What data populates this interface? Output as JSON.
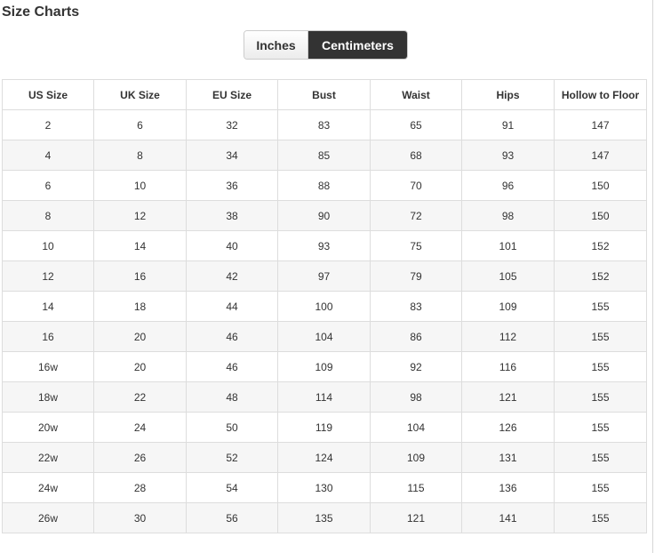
{
  "title": "Size Charts",
  "unit_toggle": {
    "inches_label": "Inches",
    "centimeters_label": "Centimeters",
    "selected": "Centimeters"
  },
  "colors": {
    "selected_button_bg": "#333333",
    "selected_button_text": "#ffffff",
    "grid_border": "#dddddd",
    "stripe": "#f6f6f6"
  },
  "table": {
    "headers": [
      "US Size",
      "UK Size",
      "EU Size",
      "Bust",
      "Waist",
      "Hips",
      "Hollow to Floor"
    ],
    "rows": [
      [
        "2",
        "6",
        "32",
        "83",
        "65",
        "91",
        "147"
      ],
      [
        "4",
        "8",
        "34",
        "85",
        "68",
        "93",
        "147"
      ],
      [
        "6",
        "10",
        "36",
        "88",
        "70",
        "96",
        "150"
      ],
      [
        "8",
        "12",
        "38",
        "90",
        "72",
        "98",
        "150"
      ],
      [
        "10",
        "14",
        "40",
        "93",
        "75",
        "101",
        "152"
      ],
      [
        "12",
        "16",
        "42",
        "97",
        "79",
        "105",
        "152"
      ],
      [
        "14",
        "18",
        "44",
        "100",
        "83",
        "109",
        "155"
      ],
      [
        "16",
        "20",
        "46",
        "104",
        "86",
        "112",
        "155"
      ],
      [
        "16w",
        "20",
        "46",
        "109",
        "92",
        "116",
        "155"
      ],
      [
        "18w",
        "22",
        "48",
        "114",
        "98",
        "121",
        "155"
      ],
      [
        "20w",
        "24",
        "50",
        "119",
        "104",
        "126",
        "155"
      ],
      [
        "22w",
        "26",
        "52",
        "124",
        "109",
        "131",
        "155"
      ],
      [
        "24w",
        "28",
        "54",
        "130",
        "115",
        "136",
        "155"
      ],
      [
        "26w",
        "30",
        "56",
        "135",
        "121",
        "141",
        "155"
      ]
    ]
  }
}
